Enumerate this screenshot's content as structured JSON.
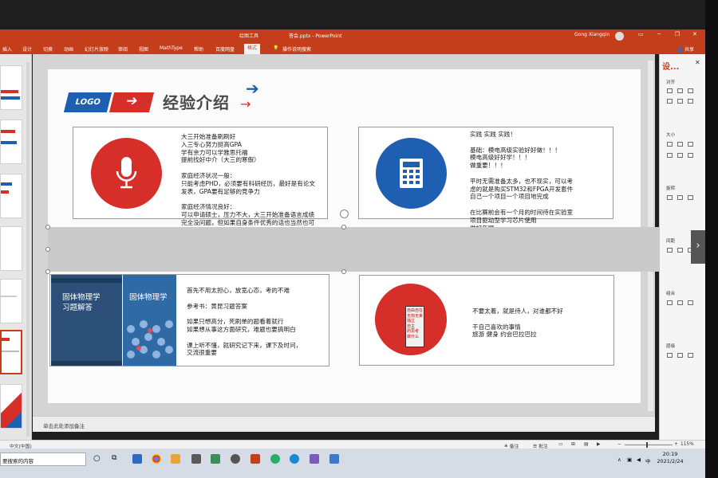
{
  "titlebar": {
    "context_tab": "绘图工具",
    "title": "答会.pptx - PowerPoint",
    "user": "Gong Xiangqin",
    "minimize": "─",
    "restore": "❐",
    "close": "✕"
  },
  "ribbon": {
    "tabs": [
      "插入",
      "设计",
      "切换",
      "动画",
      "幻灯片放映",
      "审阅",
      "视图",
      "MathType",
      "帮助",
      "百度网盘",
      "格式"
    ],
    "active_tab": "格式",
    "tell_me": "操作说明搜索",
    "share": "共享"
  },
  "slide": {
    "logo_text": "LOGO",
    "arrow": "➔",
    "title": "经验介绍",
    "deco_arrow_blue": "➔",
    "deco_arrow_red": "→",
    "cards": {
      "top_left": "大三开始准备刷刷好\n入三专心努力挺高GPA\n学有余力可以学雅思托福\n提前找好中介（大三的寒假）\n\n家庭经济状况一般：\n只能考虑PHD，必须要有科研经历，最好是有论文\n发表，GPA要有足够的竞争力\n\n家庭经济情况良好：\n可以申请硕士，压力不大，大三开始准备语言成绩\n完全没问题，但如果自身条件优秀的话也当然也可\n以考虑PHD",
      "top_right": "实践 实践 实践！\n\n基础：模电高级实验好好做！！！\n模电高级好好学！！！\n做重要！！！\n\n平时无需准备太多，也不现实，可以考\n虑的就是购买STM32和FPGA开发套件\n自己一个项目一个项目地完成\n\n在比赛前会有一个月的时间待在实验室\n项目驱动型学习芯片使用\n做好年题",
      "bottom_left": "首先不用太担心，放宽心态，考的不难\n\n参考书：黄昆习题答案\n\n如果只想高分，死刷单的题看着就行\n如果想从事这方面研究，难题也要搞明白\n\n课上听不懂，就研究记下来，课下及时问，\n交流很重要",
      "bottom_right": "不要太着，就是待人，对谁都不好\n\n干自己喜欢的事情\n旅游 健身 约会巴拉巴拉"
    },
    "icons": {
      "top_left": "microphone-icon",
      "top_right": "calculator-icon"
    },
    "books": [
      {
        "title": "固体物理学\n习题解答"
      },
      {
        "title": "固体物理学"
      }
    ],
    "poster_text": "自由自在\n无拘无束\n独立\n自主\n的思考\n做什么"
  },
  "notes": {
    "placeholder": "单击此处添加备注"
  },
  "right_panel": {
    "header": "设...",
    "close": "✕",
    "sections": [
      "对齐",
      "大小",
      "旋转",
      "间距",
      "组合",
      "层级"
    ]
  },
  "statusbar": {
    "language": "中文(中国)",
    "notes_btn": "≜ 备注",
    "comments_btn": "☰ 批注",
    "zoom": "115%"
  },
  "taskbar": {
    "search_placeholder": "要搜索的内容",
    "tray_lang": "中",
    "time": "20:19",
    "date": "2021/2/24"
  },
  "colors": {
    "accent": "#c43e1c",
    "brand_red": "#d62e29",
    "brand_blue": "#1f5fb1"
  }
}
